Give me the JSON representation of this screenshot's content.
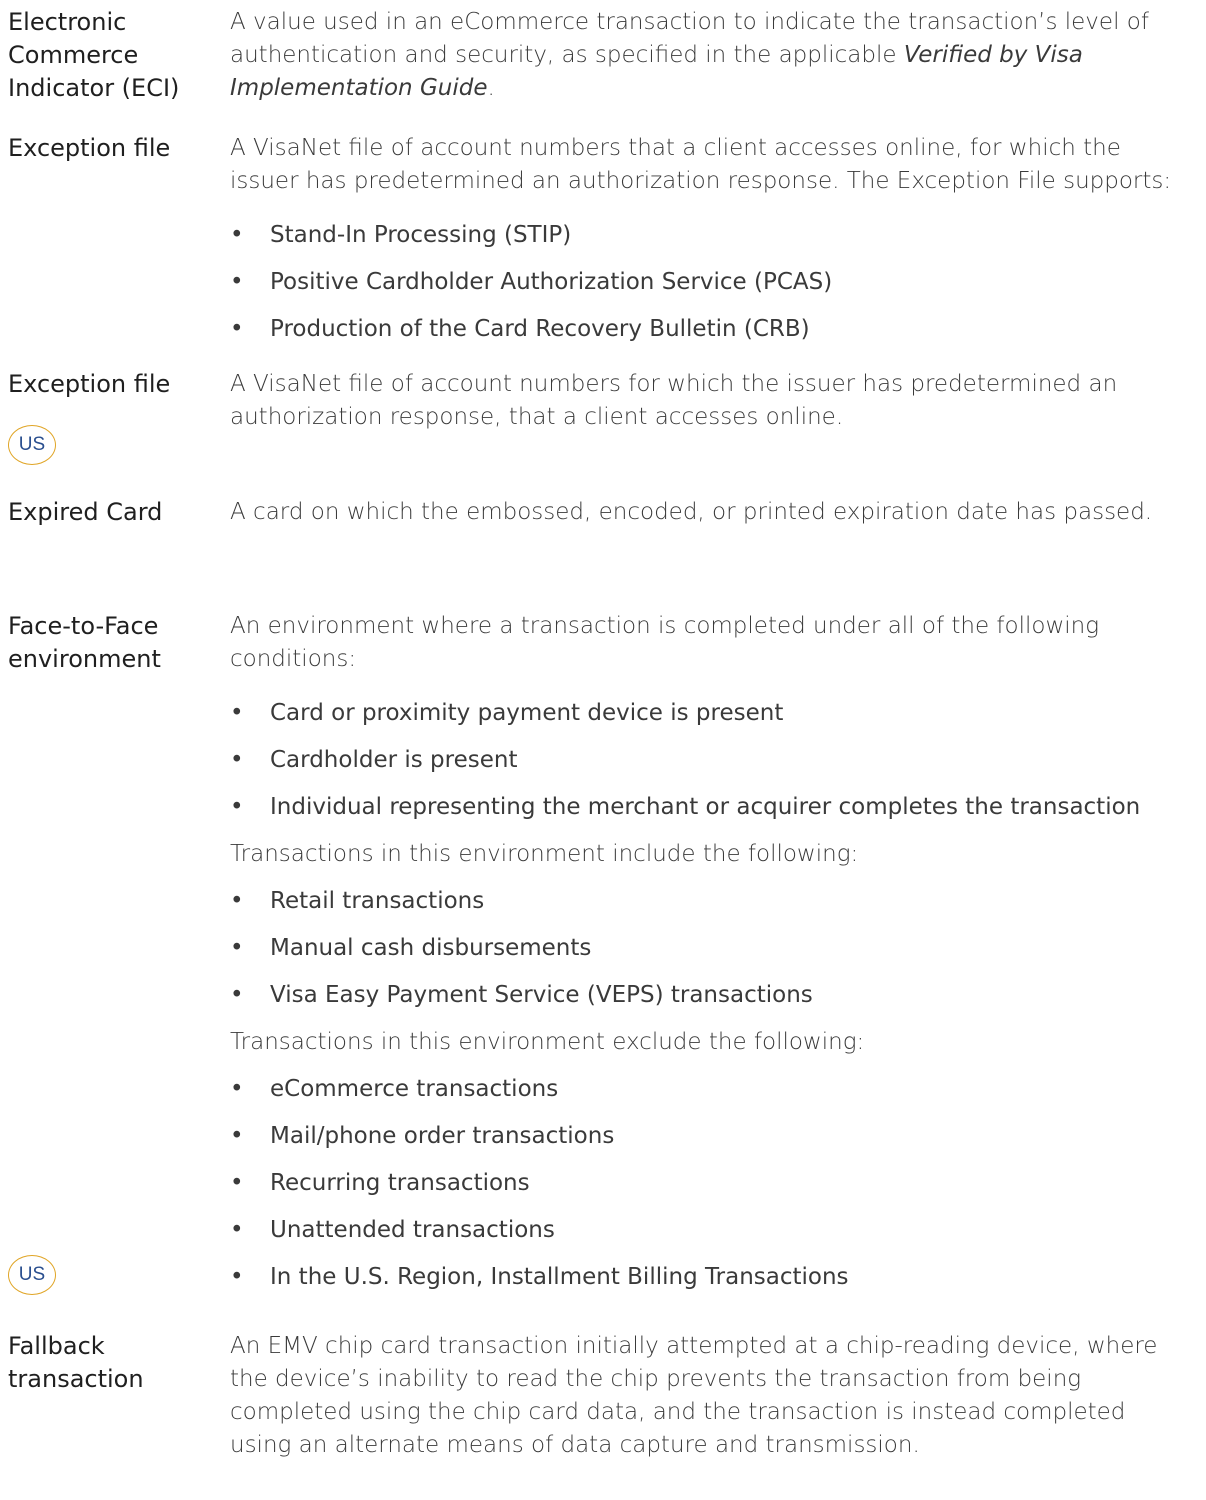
{
  "entries": [
    {
      "term": "Electronic Commerce Indicator (ECI)",
      "definition_pre": "A value used in an eCommerce transaction to indicate the transaction’s level of authentication and security, as specified in the applicable ",
      "definition_em": "Verified by Visa Implementation Guide",
      "definition_post": "."
    },
    {
      "term": "Exception file",
      "definition": "A VisaNet file of account numbers that a client accesses online, for which the issuer has predetermined an authorization response. The Exception File supports:",
      "bullets": [
        "Stand-In Processing (STIP)",
        "Positive Cardholder Authorization Service (PCAS)",
        "Production of the Card Recovery Bulletin (CRB)"
      ]
    },
    {
      "term": "Exception file",
      "region_badge": "US",
      "definition": "A VisaNet file of account numbers for which the issuer has predetermined an authorization response, that a client accesses online."
    },
    {
      "term": "Expired Card",
      "definition": "A card on which the embossed, encoded, or printed expiration date has passed."
    },
    {
      "term": "Face-to-Face environment",
      "definition": "An environment where a transaction is completed under all of the following conditions:",
      "bullets_1": [
        "Card or proximity payment device is present",
        "Cardholder is present",
        "Individual representing the merchant or acquirer completes the transaction"
      ],
      "include_intro": "Transactions in this environment include the following:",
      "include_bullets": [
        "Retail transactions",
        "Manual cash disbursements",
        "Visa Easy Payment Service (VEPS) transactions"
      ],
      "exclude_intro": "Transactions in this environment exclude the following:",
      "exclude_bullets": [
        "eCommerce transactions",
        "Mail/phone order transactions",
        "Recurring transactions",
        "Unattended transactions",
        "In the U.S. Region, Installment Billing Transactions"
      ],
      "region_badge": "US"
    },
    {
      "term": "Fallback transaction",
      "definition": "An EMV chip card transaction initially attempted at a chip-reading device, where the device’s inability to read the chip prevents the transaction from being completed using the chip card data, and the transaction is instead completed using an alternate means of data capture and transmission."
    }
  ],
  "bullet_char": "•"
}
